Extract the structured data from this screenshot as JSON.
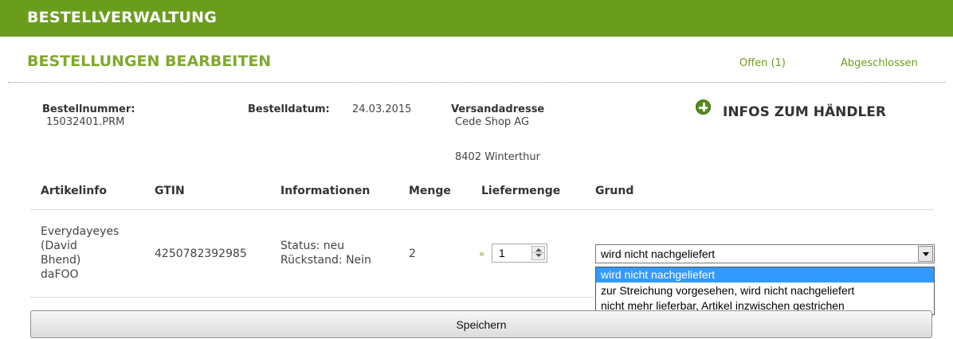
{
  "header": {
    "title": "BESTELLVERWALTUNG"
  },
  "page": {
    "subtitle": "BESTELLUNGEN BEARBEITEN",
    "tabs": [
      {
        "label": "Offen (1)"
      },
      {
        "label": "Abgeschlossen"
      }
    ]
  },
  "order": {
    "number_label": "Bestellnummer:",
    "number": "15032401.PRM",
    "date_label": "Bestelldatum:",
    "date": "24.03.2015",
    "address_label": "Versandadresse",
    "address_name": "Cede Shop AG",
    "address_city": "8402 Winterthur",
    "dealer_info_label": "INFOS ZUM HÄNDLER"
  },
  "table": {
    "headers": [
      "Artikelinfo",
      "GTIN",
      "Informationen",
      "Menge",
      "Liefermenge",
      "Grund"
    ],
    "row": {
      "article_lines": [
        "Everydayeyes",
        "(David",
        "Bhend)",
        "daFOO"
      ],
      "gtin": "4250782392985",
      "status": "Status: neu",
      "backlog": "Rückstand: Nein",
      "quantity": "2",
      "delivery_marker": "»",
      "delivery_quantity": "1",
      "reason_selected": "wird nicht nachgeliefert",
      "reason_options": [
        "wird nicht nachgeliefert",
        "zur Streichung vorgesehen, wird nicht nachgeliefert",
        "nicht mehr lieferbar, Artikel inzwischen gestrichen"
      ]
    }
  },
  "actions": {
    "save_label": "Speichern"
  },
  "colors": {
    "brand_green": "#6b9d1c",
    "subtitle_green": "#80a830",
    "selection_blue": "#3399ff"
  },
  "icons": {
    "dealer_info": "plus-circle-icon",
    "spinner": "spinner-arrows-icon",
    "select": "dropdown-arrow-icon"
  }
}
